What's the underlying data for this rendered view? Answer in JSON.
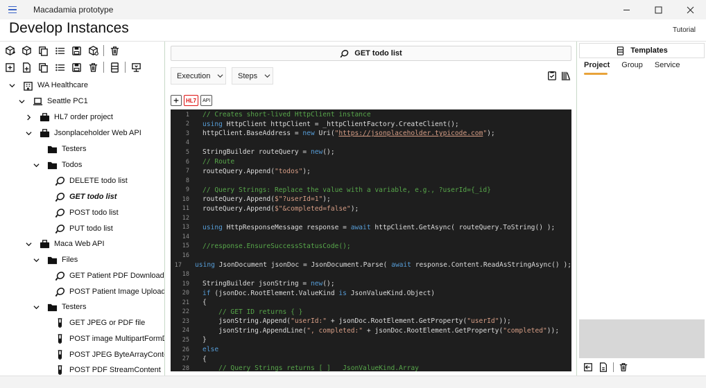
{
  "window": {
    "app_title": "Macadamia prototype",
    "controls": [
      "minimize",
      "maximize",
      "close"
    ]
  },
  "header": {
    "title": "Develop Instances",
    "tutorial_label": "Tutorial"
  },
  "left_toolbar": {
    "row1_icons": [
      "cube-add-icon",
      "cube-icon",
      "copy-icon",
      "list-icon",
      "save-icon",
      "cube-settings-icon",
      "delete-icon"
    ],
    "row2_icons": [
      "add-box-icon",
      "new-file-icon",
      "copy-icon",
      "list-icon",
      "save-icon",
      "delete-icon",
      "panel-icon",
      "deploy-icon"
    ]
  },
  "tree": [
    {
      "label": "WA Healthcare",
      "icon": "building-icon",
      "expanded": true
    },
    {
      "label": "Seattle PC1",
      "icon": "laptop-icon",
      "expanded": true
    },
    {
      "label": "HL7 order project",
      "icon": "briefcase-icon",
      "expanded": false
    },
    {
      "label": "Jsonplaceholder Web API",
      "icon": "briefcase-icon",
      "expanded": true
    },
    {
      "label": "Testers",
      "icon": "folder-icon"
    },
    {
      "label": "Todos",
      "icon": "folder-icon",
      "expanded": true
    },
    {
      "label": "DELETE todo list",
      "icon": "nut-icon"
    },
    {
      "label": "GET todo list",
      "icon": "nut-icon",
      "selected": true
    },
    {
      "label": "POST todo list",
      "icon": "nut-icon"
    },
    {
      "label": "PUT todo list",
      "icon": "nut-icon"
    },
    {
      "label": "Maca Web API",
      "icon": "briefcase-icon",
      "expanded": true
    },
    {
      "label": "Files",
      "icon": "folder-icon",
      "expanded": true
    },
    {
      "label": "GET Patient PDF Downloader",
      "icon": "nut-icon"
    },
    {
      "label": "POST Patient Image Uploader",
      "icon": "nut-icon"
    },
    {
      "label": "Testers",
      "icon": "folder-icon",
      "expanded": true
    },
    {
      "label": "GET JPEG or PDF file",
      "icon": "test-tube-icon"
    },
    {
      "label": "POST image MultipartFormData",
      "icon": "test-tube-icon"
    },
    {
      "label": "POST JPEG ByteArrayContent",
      "icon": "test-tube-icon"
    },
    {
      "label": "POST PDF StreamContent",
      "icon": "test-tube-icon"
    }
  ],
  "center": {
    "request_title": "GET todo list",
    "execution_label": "Execution",
    "steps_label": "Steps",
    "hl7_label": "HL7",
    "api_label": "API"
  },
  "code_lines": [
    "// Creates short-lived HttpClient instance",
    "using HttpClient httpClient = _httpClientFactory.CreateClient();",
    "httpClient.BaseAddress = new Uri(\"https://jsonplaceholder.typicode.com\");",
    "",
    "StringBuilder routeQuery = new();",
    "// Route",
    "routeQuery.Append(\"todos\");",
    "",
    "// Query Strings: Replace the value with a variable, e.g., ?userId={_id}",
    "routeQuery.Append($\"?userId=1\");",
    "routeQuery.Append($\"&completed=false\");",
    "",
    "using HttpResponseMessage response = await httpClient.GetAsync( routeQuery.ToString() );",
    "",
    "//response.EnsureSuccessStatusCode();",
    "",
    "using JsonDocument jsonDoc = JsonDocument.Parse( await response.Content.ReadAsStringAsync() );",
    "",
    "StringBuilder jsonString = new();",
    "if (jsonDoc.RootElement.ValueKind is JsonValueKind.Object)",
    "{",
    "    // GET ID returns { }",
    "    jsonString.Append(\"userId:\" + jsonDoc.RootElement.GetProperty(\"userId\"));",
    "    jsonString.AppendLine(\", completed:\" + jsonDoc.RootElement.GetProperty(\"completed\"));",
    "}",
    "else",
    "{",
    "    // Query Strings returns [ ]   JsonValueKind.Array"
  ],
  "right_panel": {
    "title": "Templates",
    "tabs": [
      "Project",
      "Group",
      "Service"
    ],
    "active_tab": "Project"
  },
  "colors": {
    "editor_bg": "#1e1e1e",
    "comment": "#57a64a",
    "keyword": "#569cd6",
    "string": "#d69d85",
    "accent": "#e8a33a"
  }
}
